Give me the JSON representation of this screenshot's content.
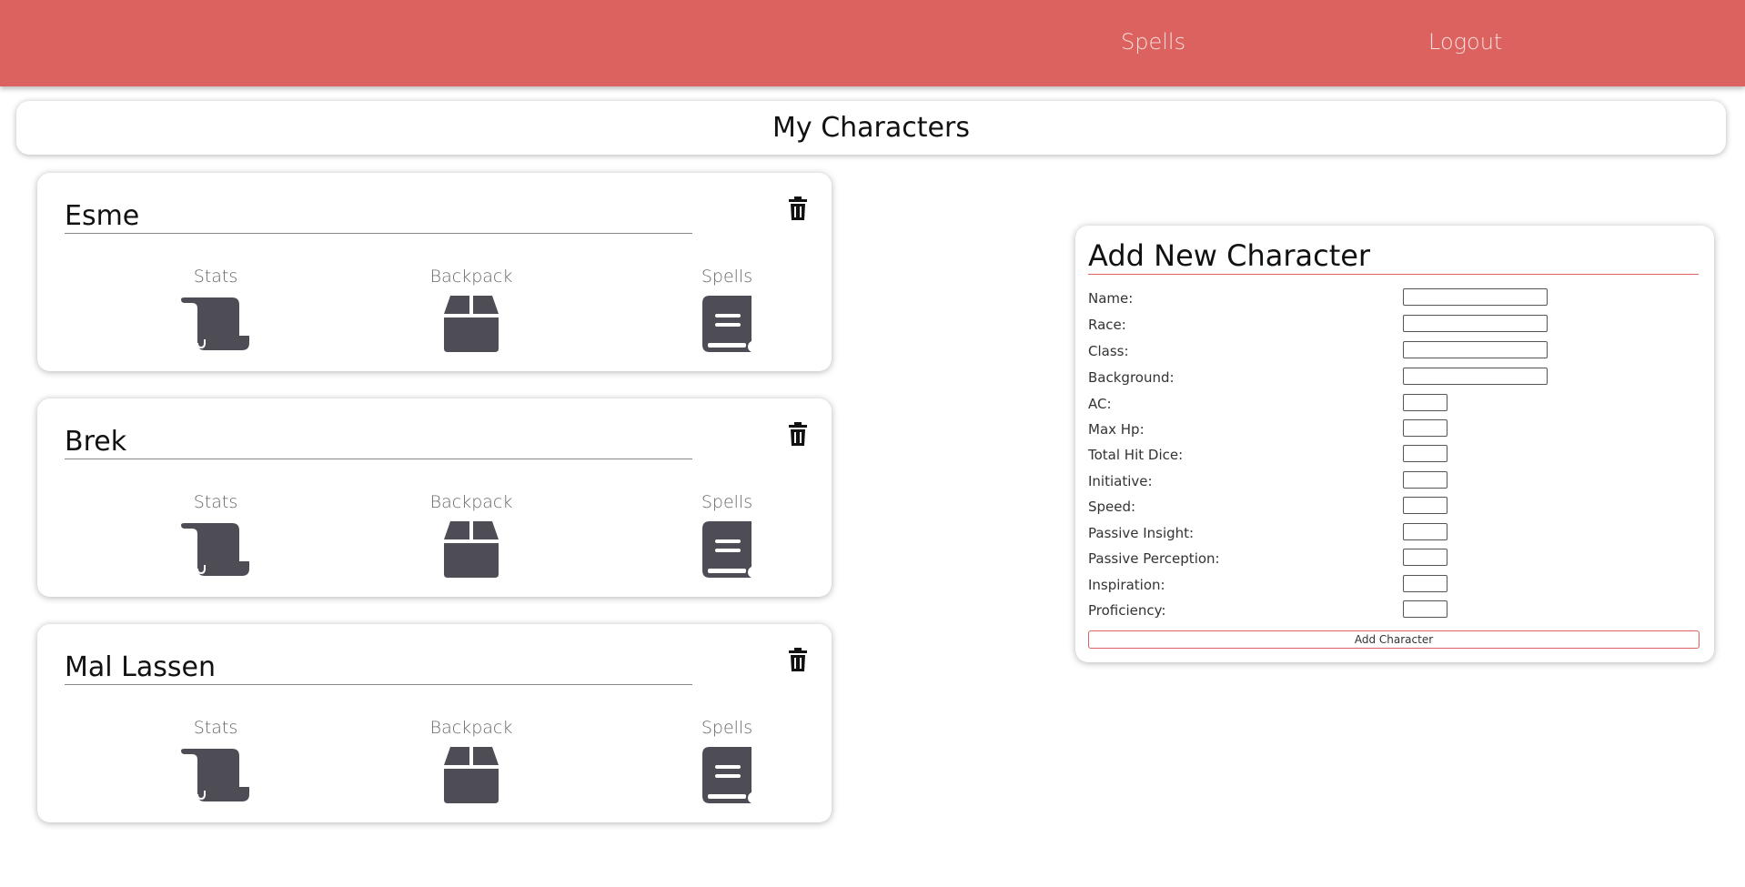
{
  "nav": {
    "spells_label": "Spells",
    "logout_label": "Logout"
  },
  "page_title": "My Characters",
  "characters": [
    {
      "name": "Esme"
    },
    {
      "name": "Brek"
    },
    {
      "name": "Mal Lassen"
    }
  ],
  "tools": {
    "stats_label": "Stats",
    "backpack_label": "Backpack",
    "spells_label": "Spells"
  },
  "add_form": {
    "title": "Add New Character",
    "labels": {
      "name": "Name:",
      "race": "Race:",
      "class": "Class:",
      "background": "Background:",
      "ac": "AC:",
      "max_hp": "Max Hp:",
      "total_hit_dice": "Total Hit Dice:",
      "initiative": "Initiative:",
      "speed": "Speed:",
      "passive_insight": "Passive Insight:",
      "passive_perception": "Passive Perception:",
      "inspiration": "Inspiration:",
      "proficiency": "Proficiency:"
    },
    "button_label": "Add Character"
  },
  "colors": {
    "brand": "#dc625f",
    "icon": "#4e4d55"
  },
  "icons": {
    "stats": "scroll-icon",
    "backpack": "box-icon",
    "spells": "book-icon",
    "delete": "trash-icon"
  }
}
